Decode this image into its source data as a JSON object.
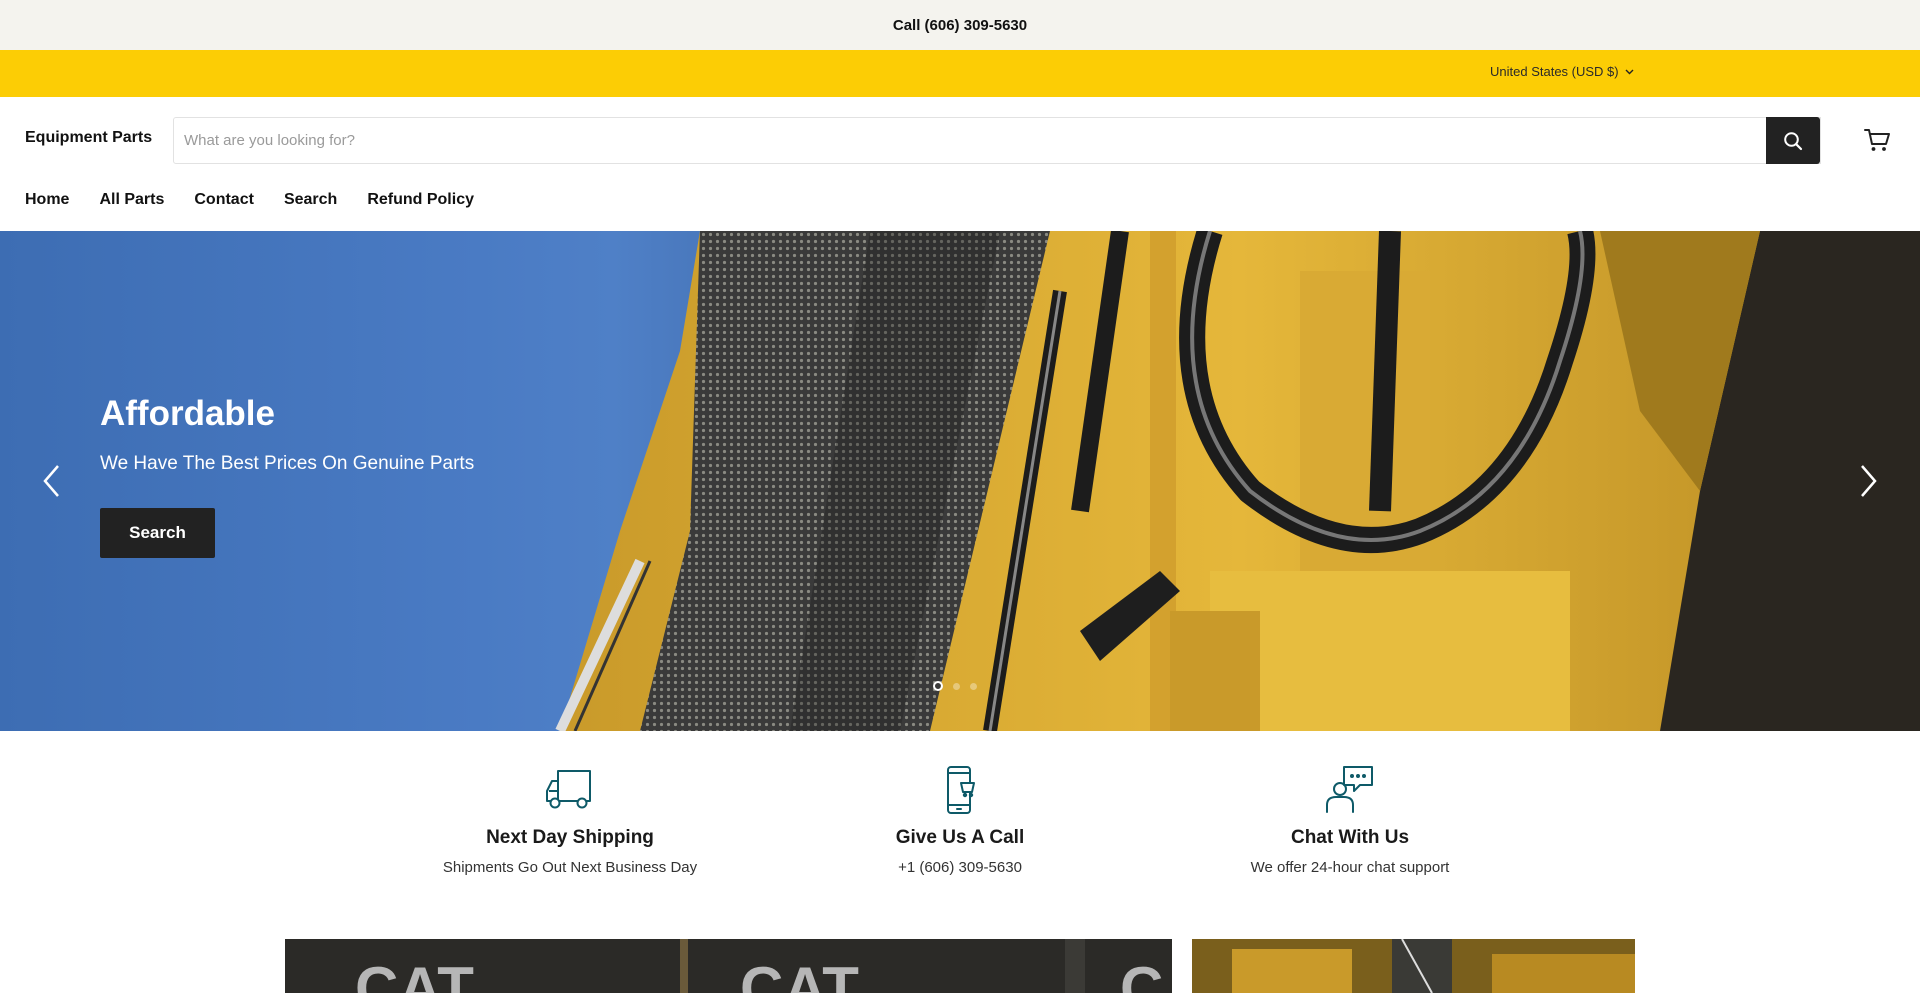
{
  "announcement": {
    "text": "Call (606) 309-5630"
  },
  "utility": {
    "currency_label": "United States (USD $)"
  },
  "header": {
    "logo": "Equipment Parts",
    "search_placeholder": "What are you looking for?"
  },
  "nav": {
    "items": [
      {
        "label": "Home"
      },
      {
        "label": "All Parts"
      },
      {
        "label": "Contact"
      },
      {
        "label": "Search"
      },
      {
        "label": "Refund Policy"
      }
    ]
  },
  "hero": {
    "title": "Affordable",
    "subtitle": "We Have The Best Prices On Genuine Parts",
    "button_label": "Search",
    "slide_count": 3,
    "active_slide": 1
  },
  "features": [
    {
      "icon": "truck-icon",
      "title": "Next Day Shipping",
      "text": "Shipments Go Out Next Business Day"
    },
    {
      "icon": "phone-icon",
      "title": "Give Us A Call",
      "text": "+1 (606) 309-5630"
    },
    {
      "icon": "chat-icon",
      "title": "Chat With Us",
      "text": "We offer 24-hour chat support"
    }
  ],
  "colors": {
    "yellow_bar": "#fccd05",
    "topbar_bg": "#f4f3ee",
    "dark_button": "#222222",
    "icon_teal": "#0e5a68"
  }
}
